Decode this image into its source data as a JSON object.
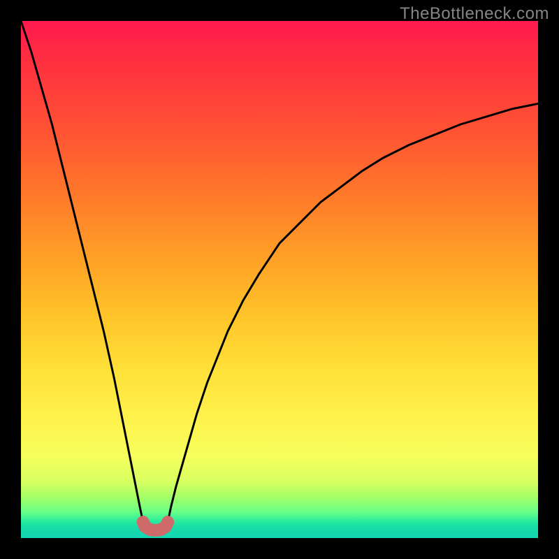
{
  "watermark": "TheBottleneck.com",
  "colors": {
    "frame_bg": "#000000",
    "curve_stroke": "#000000",
    "cusp_stroke": "#cf6a6a",
    "gradient_top": "#ff1a4d",
    "gradient_bottom": "#12d6b4"
  },
  "chart_data": {
    "type": "line",
    "title": "",
    "xlabel": "",
    "ylabel": "",
    "xlim": [
      0,
      100
    ],
    "ylim": [
      0,
      100
    ],
    "grid": false,
    "note": "y is rendered with 0 at bottom (chart value); pixel y in SVG = 740*(1 - y/100).",
    "series": [
      {
        "name": "left-branch",
        "x": [
          0,
          2,
          4,
          6,
          8,
          10,
          12,
          14,
          16,
          18,
          19,
          20,
          21,
          22,
          23,
          23.6
        ],
        "y": [
          100,
          94,
          87,
          80,
          72,
          64,
          56,
          48,
          40,
          31,
          26,
          21,
          16,
          11,
          6,
          3.1
        ]
      },
      {
        "name": "cusp-highlight",
        "x": [
          23.6,
          24,
          25,
          26,
          27,
          28,
          28.4
        ],
        "y": [
          3.1,
          2.2,
          1.6,
          1.5,
          1.6,
          2.2,
          3.1
        ]
      },
      {
        "name": "right-branch",
        "x": [
          28.4,
          29,
          30,
          32,
          34,
          36,
          38,
          40,
          43,
          46,
          50,
          54,
          58,
          62,
          66,
          70,
          75,
          80,
          85,
          90,
          95,
          100
        ],
        "y": [
          3.1,
          6,
          10,
          17,
          24,
          30,
          35,
          40,
          46,
          51,
          57,
          61,
          65,
          68,
          71,
          73.5,
          76,
          78,
          80,
          81.5,
          83,
          84
        ]
      }
    ]
  }
}
